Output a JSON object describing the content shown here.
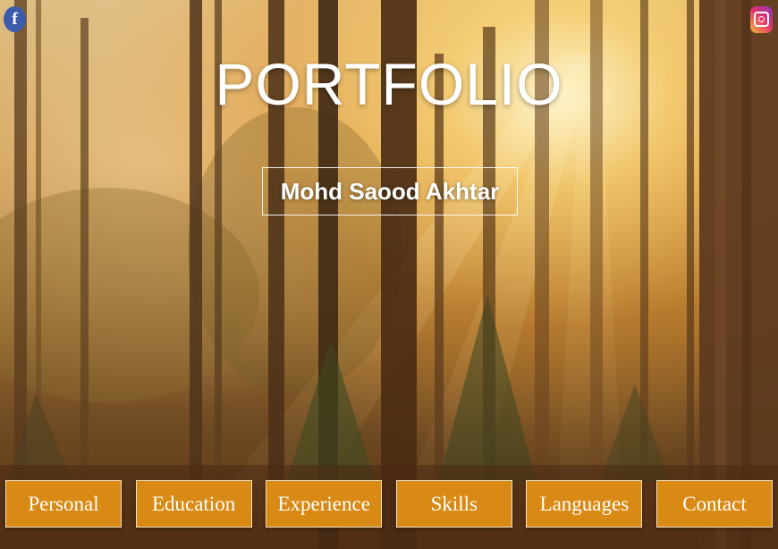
{
  "social": {
    "facebook_icon": "facebook-icon",
    "facebook_glyph": "f",
    "instagram_icon": "instagram-icon"
  },
  "hero": {
    "title": "PORTFOLIO",
    "name": "Mohd Saood Akhtar"
  },
  "nav": {
    "items": [
      {
        "label": "Personal"
      },
      {
        "label": "Education"
      },
      {
        "label": "Experience"
      },
      {
        "label": "Skills"
      },
      {
        "label": "Languages"
      },
      {
        "label": "Contact"
      }
    ]
  },
  "colors": {
    "nav_button": "#d98a14",
    "facebook": "#3b5bab",
    "text": "#ffffff"
  }
}
